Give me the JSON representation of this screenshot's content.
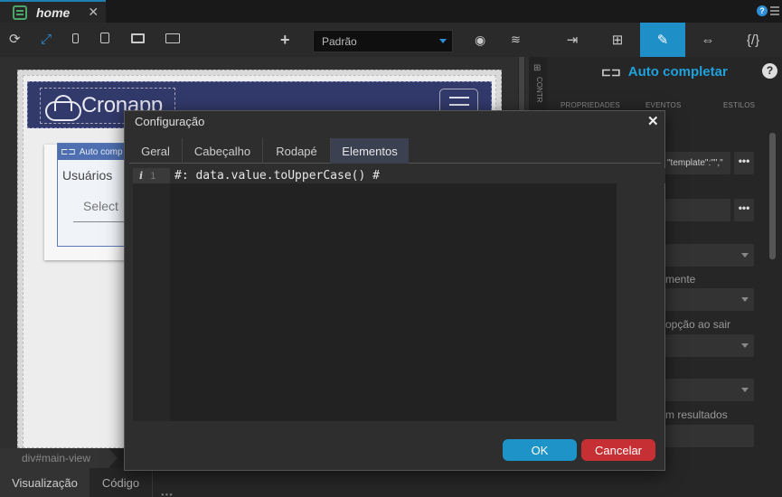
{
  "tab": {
    "label": "home",
    "close": "✕"
  },
  "toolbar": {
    "viewport_select": "Padrão",
    "icons": [
      "refresh-icon",
      "expand-icon",
      "mobile-icon",
      "tablet-icon",
      "desktop-icon",
      "monitor-icon",
      "add-icon"
    ]
  },
  "right_panel": {
    "title": "Auto completar",
    "help": "?",
    "subtabs": [
      "PROPRIEDADES",
      "EVENTOS",
      "ESTILOS"
    ],
    "template_value": "\"template\":\"\",\"",
    "labels": [
      "mente",
      "opção ao sair",
      "m resultados"
    ],
    "dots": "•••"
  },
  "canvas": {
    "side_strip_label": "CONTR",
    "brand": "Cronapp",
    "component_tag": "Auto comp",
    "label_usuarios": "Usuários",
    "select_placeholder": "Select"
  },
  "bottom": {
    "breadcrumb": "div#main-view",
    "tabs": [
      "Visualização",
      "Código"
    ]
  },
  "modal": {
    "title": "Configuração",
    "close": "✕",
    "tabs": [
      "Geral",
      "Cabeçalho",
      "Rodapé",
      "Elementos"
    ],
    "active_tab": "Elementos",
    "line_number": "1",
    "info_marker": "i",
    "code": "#: data.value.toUpperCase() #",
    "ok_label": "OK",
    "cancel_label": "Cancelar"
  },
  "colors": {
    "accent": "#1f8fc7",
    "cancel": "#c62f33",
    "title_blue": "#1fa1db",
    "navbar": "#323a6c"
  }
}
